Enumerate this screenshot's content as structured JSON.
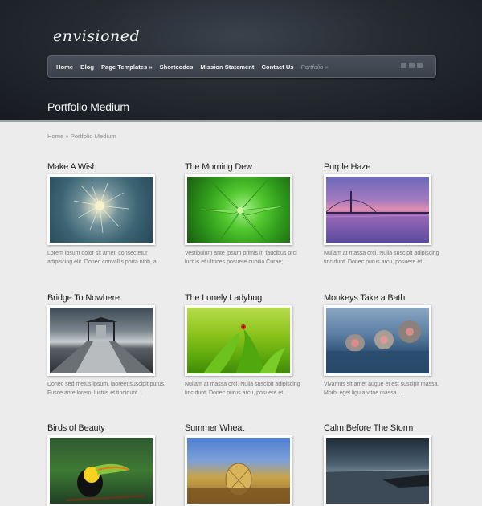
{
  "site": {
    "logo": "envisioned"
  },
  "nav": {
    "items": [
      "Home",
      "Blog",
      "Page Templates »",
      "Shortcodes",
      "Mission Statement",
      "Contact Us"
    ],
    "active": "Portfolio »"
  },
  "social": [
    "twitter-icon",
    "rss-icon",
    "facebook-icon"
  ],
  "page": {
    "title": "Portfolio Medium"
  },
  "breadcrumb": {
    "home": "Home",
    "sep": "»",
    "current": "Portfolio Medium"
  },
  "portfolio": [
    {
      "title": "Make A Wish",
      "excerpt": "Lorem ipsum dolor sit amet, consectetur adipiscing elit. Donec convallis porta nibh, a...",
      "image": "dandelion-image"
    },
    {
      "title": "The Morning Dew",
      "excerpt": "Vestibulum ante ipsum primis in faucibus orci luctus et ultrices posuere cubilia Curae;...",
      "image": "leaves-image"
    },
    {
      "title": "Purple Haze",
      "excerpt": "Nullam at massa orci. Nulla suscipit adipiscing tincidunt. Donec purus arcu, posuere et...",
      "image": "bridge-sunset-image"
    },
    {
      "title": "Bridge To Nowhere",
      "excerpt": "Donec sed metus ipsum, laoreet suscipit purus. Fusce ante lorem, luctus et tincidunt...",
      "image": "pier-image"
    },
    {
      "title": "The Lonely Ladybug",
      "excerpt": "Nullam at massa orci. Nulla suscipit adipiscing tincidunt. Donec purus arcu, posuere et...",
      "image": "ladybug-image"
    },
    {
      "title": "Monkeys Take a Bath",
      "excerpt": "Vivamus sit amet augue et est suscipit massa. Morbi eget ligula vitae massa...",
      "image": "monkeys-image"
    },
    {
      "title": "Birds of Beauty",
      "excerpt": "",
      "image": "toucan-image"
    },
    {
      "title": "Summer Wheat",
      "excerpt": "",
      "image": "wheat-image"
    },
    {
      "title": "Calm Before The Storm",
      "excerpt": "",
      "image": "storm-image"
    }
  ]
}
